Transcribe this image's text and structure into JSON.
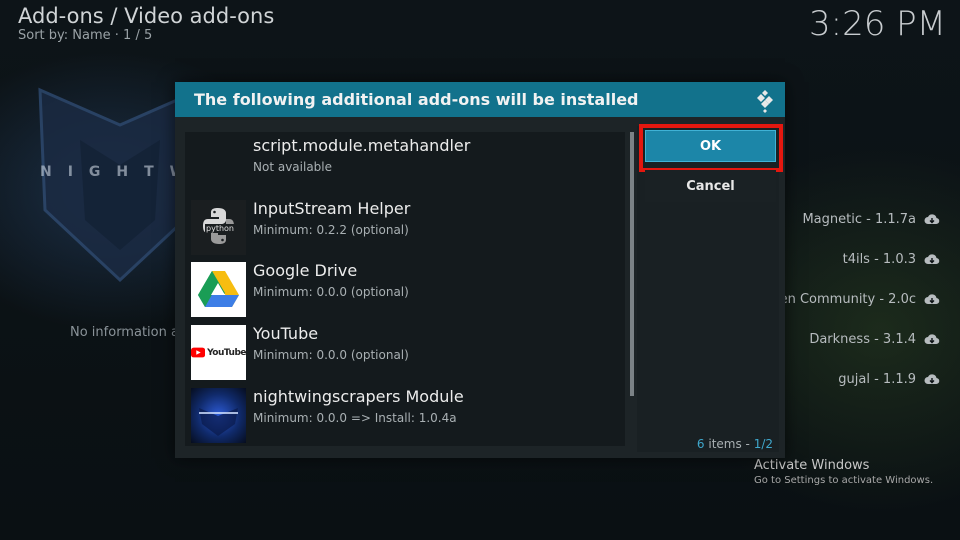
{
  "background": {
    "header_title": "Add-ons / Video add-ons",
    "header_sub": "Sort by: Name  ·  1 / 5",
    "clock": "3:26 PM",
    "logo_text": "NIGHTW",
    "no_info": "No information a",
    "list_items": [
      {
        "label": "Magnetic - 1.1.7a",
        "icon": "cloud-download-icon"
      },
      {
        "label": "t4ils - 1.0.3",
        "icon": "cloud-download-icon"
      },
      {
        "label": "en Community - 2.0c",
        "icon": "cloud-download-icon"
      },
      {
        "label": "Darkness - 3.1.4",
        "icon": "cloud-download-icon"
      },
      {
        "label": "gujal - 1.1.9",
        "icon": "cloud-download-icon"
      }
    ],
    "activate_windows": {
      "title": "Activate Windows",
      "subtitle": "Go to Settings to activate Windows."
    }
  },
  "dialog": {
    "title": "The following additional add-ons will be installed",
    "icon": "kodi-logo-icon",
    "addons": [
      {
        "name": "script.module.metahandler",
        "detail": "Not available",
        "thumb": "none"
      },
      {
        "name": "InputStream Helper",
        "detail": "Minimum: 0.2.2 (optional)",
        "thumb": "python-logo",
        "thumb_text": "python"
      },
      {
        "name": "Google Drive",
        "detail": "Minimum: 0.0.0 (optional)",
        "thumb": "google-drive-logo"
      },
      {
        "name": "YouTube",
        "detail": "Minimum: 0.0.0 (optional)",
        "thumb": "youtube-logo",
        "thumb_text": "YouTube"
      },
      {
        "name": "nightwingscrapers Module",
        "detail": "Minimum: 0.0.0 => Install: 1.0.4a",
        "thumb": "nightwing-logo"
      }
    ],
    "ok_label": "OK",
    "cancel_label": "Cancel",
    "items_count": "6",
    "items_word": " items - ",
    "page": "1/2"
  },
  "colors": {
    "header_bar": "#12728c",
    "ok_button": "#1c86a8",
    "highlight": "#e4170f"
  }
}
